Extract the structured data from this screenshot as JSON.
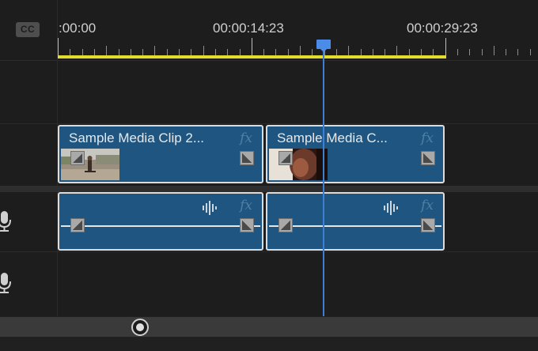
{
  "header": {
    "cc_label": "CC"
  },
  "ruler": {
    "timecodes": [
      ":00:00",
      "00:00:14:23",
      "00:00:29:23"
    ]
  },
  "video_track": {
    "clips": [
      {
        "title": "Sample Media Clip 2...",
        "fx": "fx",
        "thumbnail": "skateboarder-thumbnail"
      },
      {
        "title": "Sample Media C...",
        "fx": "fx",
        "thumbnail": "portrait-thumbnail"
      }
    ]
  },
  "audio_track": {
    "clips": [
      {
        "fx": "fx",
        "icon": "waveform-icon"
      },
      {
        "fx": "fx",
        "icon": "waveform-icon"
      }
    ]
  },
  "icons": {
    "track_headers": [
      "microphone-icon",
      "microphone-icon"
    ],
    "keyframe": "keyframe-handle-icon"
  },
  "colors": {
    "clip_fill": "#1f5681",
    "work_area": "#e2dc2d",
    "playhead": "#3f7ed6",
    "background": "#1d1d1d"
  }
}
